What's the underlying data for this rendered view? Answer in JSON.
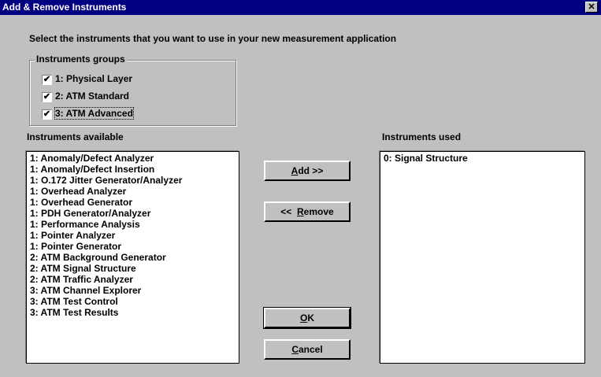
{
  "window": {
    "title": "Add & Remove Instruments",
    "close_glyph": "✕"
  },
  "instructions": "Select the instruments that you want to use in your new measurement application",
  "groups": {
    "legend": "Instruments groups",
    "items": [
      {
        "label": "1:  Physical Layer",
        "checked": true
      },
      {
        "label": "2:  ATM Standard",
        "checked": true
      },
      {
        "label": "3:  ATM Advanced",
        "checked": true
      }
    ]
  },
  "available": {
    "label": "Instruments available",
    "items": [
      "1: Anomaly/Defect Analyzer",
      "1: Anomaly/Defect Insertion",
      "1: O.172 Jitter Generator/Analyzer",
      "1: Overhead Analyzer",
      "1: Overhead Generator",
      "1: PDH Generator/Analyzer",
      "1: Performance Analysis",
      "1: Pointer Analyzer",
      "1: Pointer Generator",
      "2: ATM Background Generator",
      "2: ATM Signal Structure",
      "2: ATM Traffic Analyzer",
      "3: ATM Channel Explorer",
      "3: ATM Test Control",
      "3: ATM Test Results"
    ]
  },
  "used": {
    "label": "Instruments used",
    "items": [
      "0: Signal Structure"
    ]
  },
  "buttons": {
    "add": {
      "mnemonic": "A",
      "rest": "dd  >>"
    },
    "remove": {
      "prefix": "<<  ",
      "mnemonic": "R",
      "rest": "emove"
    },
    "ok": {
      "mnemonic": "O",
      "rest": "K"
    },
    "cancel": {
      "mnemonic": "C",
      "rest": "ancel"
    }
  }
}
